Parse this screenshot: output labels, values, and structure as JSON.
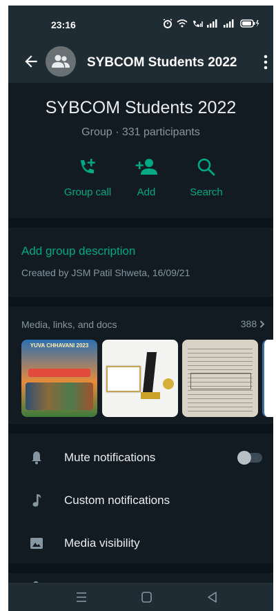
{
  "status_bar": {
    "time": "23:16",
    "icons": [
      "alarm-icon",
      "wifi-icon",
      "call-signal-icon",
      "signal-1-icon",
      "signal-2-icon",
      "battery-charging-icon"
    ]
  },
  "header": {
    "title": "SYBCOM Students 2022",
    "back_icon": "arrow-left-icon",
    "avatar_icon": "group-avatar-icon",
    "menu_icon": "more-vertical-icon"
  },
  "group": {
    "name": "SYBCOM Students 2022",
    "subtitle": "Group · 331 participants"
  },
  "actions": [
    {
      "label": "Group call",
      "icon": "add-call-icon"
    },
    {
      "label": "Add",
      "icon": "add-person-icon"
    },
    {
      "label": "Search",
      "icon": "search-icon"
    }
  ],
  "description": {
    "link": "Add group description",
    "created": "Created by JSM Patil Shweta, 16/09/21"
  },
  "media": {
    "title": "Media, links, and docs",
    "count": "388",
    "chevron_icon": "chevron-right-icon",
    "thumbnails": [
      {
        "caption": "YUVA CHHAVANI 2023",
        "kind": "event-poster"
      },
      {
        "caption": "",
        "kind": "trophy-photo"
      },
      {
        "caption": "",
        "kind": "document-photo"
      },
      {
        "caption": "",
        "kind": "poster-partial"
      }
    ]
  },
  "settings": [
    {
      "label": "Mute notifications",
      "icon": "bell-icon",
      "toggle": false
    },
    {
      "label": "Custom notifications",
      "icon": "music-note-icon"
    },
    {
      "label": "Media visibility",
      "icon": "image-icon"
    }
  ],
  "nav": [
    "menu-lines-icon",
    "home-square-icon",
    "back-triangle-icon"
  ],
  "colors": {
    "background": "#121b22",
    "bar": "#1f2c34",
    "accent": "#00a884",
    "text_primary": "#e9edef",
    "text_secondary": "#8696a0"
  }
}
